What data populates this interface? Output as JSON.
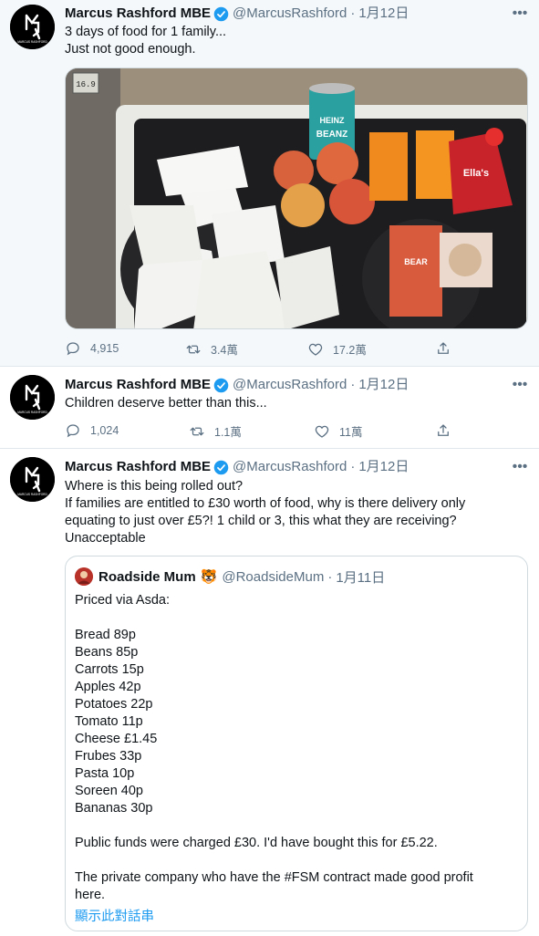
{
  "tweets": [
    {
      "author": "Marcus Rashford MBE",
      "handle": "@MarcusRashford",
      "date": "1月12日",
      "lines": [
        "3 days of food for 1 family...",
        "Just not good enough."
      ],
      "counts": {
        "reply": "4,915",
        "retweet": "3.4萬",
        "like": "17.2萬"
      }
    },
    {
      "author": "Marcus Rashford MBE",
      "handle": "@MarcusRashford",
      "date": "1月12日",
      "lines": [
        "Children deserve better than this..."
      ],
      "counts": {
        "reply": "1,024",
        "retweet": "1.1萬",
        "like": "11萬"
      }
    },
    {
      "author": "Marcus Rashford MBE",
      "handle": "@MarcusRashford",
      "date": "1月12日",
      "lines": [
        "Where is this being rolled out?",
        "If families are entitled to £30 worth of food, why is there delivery only",
        "equating to just over £5?! 1 child or 3, this what they are receiving?",
        "Unacceptable"
      ]
    }
  ],
  "avatar_text": "MARCUS RASHFORD",
  "photo_text": {
    "clock": "16.9",
    "can_brand": "HEINZ",
    "can_product": "BEANZ",
    "pouch": "Ella's",
    "snack": "BEAR"
  },
  "quote": {
    "author": "Roadside Mum",
    "emoji": "🐯",
    "handle": "@RoadsideMum",
    "date": "1月11日",
    "lines": [
      "Priced via Asda:",
      "",
      "Bread 89p",
      "Beans 85p",
      "Carrots 15p",
      "Apples 42p",
      "Potatoes 22p",
      "Tomato 11p",
      "Cheese £1.45",
      "Frubes 33p",
      "Pasta 10p",
      "Soreen 40p",
      "Bananas 30p",
      "",
      "Public funds were charged £30. I'd have bought this for £5.22.",
      "",
      "The private company who have the #FSM contract made good profit",
      "here."
    ],
    "show_thread": "顯示此對話串"
  },
  "colors": {
    "verified": "#1d9bf0",
    "link": "#1d9bf0",
    "muted": "#5b7083",
    "first_bg": "#f5f8fa"
  }
}
